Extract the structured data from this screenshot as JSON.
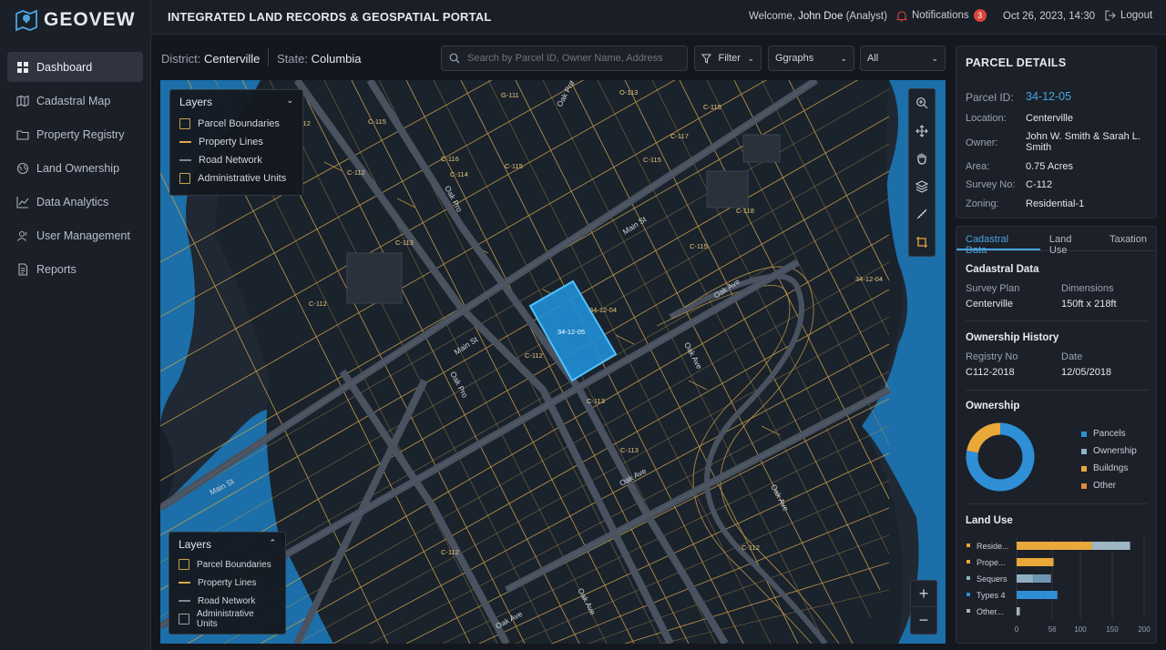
{
  "app": {
    "name": "GEOVEW",
    "title": "INTEGRATED LAND RECORDS & GEOSPATIAL PORTAL"
  },
  "header": {
    "welcome_prefix": "Welcome,",
    "user": "John Doe",
    "role": "(Analyst)",
    "notifications_label": "Notifications",
    "notifications_count": "3",
    "datetime": "Oct 26, 2023, 14:30",
    "logout": "Logout"
  },
  "sidebar": {
    "items": [
      {
        "label": "Dashboard",
        "icon": "grid-icon"
      },
      {
        "label": "Cadastral Map",
        "icon": "map-icon"
      },
      {
        "label": "Property Registry",
        "icon": "folder-icon"
      },
      {
        "label": "Land Ownership",
        "icon": "globe-icon"
      },
      {
        "label": "Data Analytics",
        "icon": "chart-icon"
      },
      {
        "label": "User Management",
        "icon": "users-icon"
      },
      {
        "label": "Reports",
        "icon": "document-icon"
      }
    ]
  },
  "context": {
    "district_label": "District:",
    "district": "Centerville",
    "state_label": "State:",
    "state": "Columbia"
  },
  "search": {
    "placeholder": "Search by Parcel ID, Owner Name, Address"
  },
  "filters": {
    "filter": "Filter",
    "graphs": "Ggraphs",
    "all": "All"
  },
  "layers_top": {
    "title": "Layers",
    "items": [
      "Parcel Boundaries",
      "Property Lines",
      "Road Network",
      "Administrative Units"
    ]
  },
  "layers_bottom": {
    "title": "Layers",
    "items": [
      "Parcel Boundaries",
      "Property Lines",
      "Road Network",
      "Administrative Units"
    ]
  },
  "map_labels": {
    "parcels": [
      "G-111",
      "O-113",
      "C-115",
      "C-112",
      "C-115",
      "C-114",
      "C-115",
      "C-117",
      "C-116",
      "C-112",
      "C-115",
      "C-118",
      "C-113",
      "C-115",
      "C-112",
      "34-12-04",
      "34-12-04",
      "34-12-05",
      "C-112",
      "C-113",
      "C-113",
      "C-112",
      "C-112"
    ],
    "streets": [
      "Oak Pro",
      "Oak Pro",
      "Main St",
      "Oak Ave",
      "Main St",
      "Oak Pro",
      "Oak Ave",
      "Main St",
      "Oak Ave",
      "Oak Ave",
      "Oak Ave",
      "Oak Ave"
    ]
  },
  "parcel": {
    "title": "PARCEL DETAILS",
    "id_label": "Parcel ID:",
    "id": "34-12-05",
    "location_label": "Location:",
    "location": "Centerville",
    "owner_label": "Owner:",
    "owner": "John W. Smith & Sarah L. Smith",
    "area_label": "Area:",
    "area": "0.75 Acres",
    "survey_label": "Survey No:",
    "survey": "C-112",
    "zoning_label": "Zoning:",
    "zoning": "Residential-1"
  },
  "tabs": [
    "Cadastral Data",
    "Land Use",
    "Taxation"
  ],
  "cadastral": {
    "title": "Cadastral Data",
    "survey_plan_label": "Survey Plan",
    "survey_plan": "Centerville",
    "dimensions_label": "Dimensions",
    "dimensions": "150ft x 218ft"
  },
  "history": {
    "title": "Ownership History",
    "registry_label": "Registry No",
    "registry": "C112-2018",
    "date_label": "Date",
    "date": "12/05/2018"
  },
  "ownership": {
    "title": "Ownership",
    "legend": [
      {
        "name": "Pancels",
        "color": "#2e8fd6"
      },
      {
        "name": "Ownership",
        "color": "#8fb4c9"
      },
      {
        "name": "Buildngs",
        "color": "#e8a83a"
      },
      {
        "name": "Other",
        "color": "#e08a3a"
      }
    ]
  },
  "chart_data": [
    {
      "type": "pie",
      "title": "Ownership",
      "categories": [
        "Pancels",
        "Ownership",
        "Buildngs",
        "Other"
      ],
      "values": [
        78,
        0,
        22,
        0
      ]
    },
    {
      "type": "bar",
      "title": "Land Use",
      "orientation": "horizontal",
      "categories": [
        "Reside...",
        "Prope...",
        "Sequers",
        "Types 4",
        "Other..."
      ],
      "series": [
        {
          "values": [
            118,
            58,
            26,
            42,
            5
          ]
        },
        {
          "values": [
            60,
            0,
            28,
            22,
            0
          ]
        }
      ],
      "colors": [
        [
          "#e8a83a",
          "#9fb6c4"
        ],
        [
          "#e8a83a",
          "#9fb6c4"
        ],
        [
          "#8fb0c2",
          "#6f96b3"
        ],
        [
          "#2e8fd6",
          "#2e8fd6"
        ],
        [
          "#aab1bb",
          "#aab1bb"
        ]
      ],
      "xticks": [
        "0",
        "56",
        "100",
        "150",
        "200"
      ],
      "xlim": [
        0,
        200
      ]
    }
  ]
}
